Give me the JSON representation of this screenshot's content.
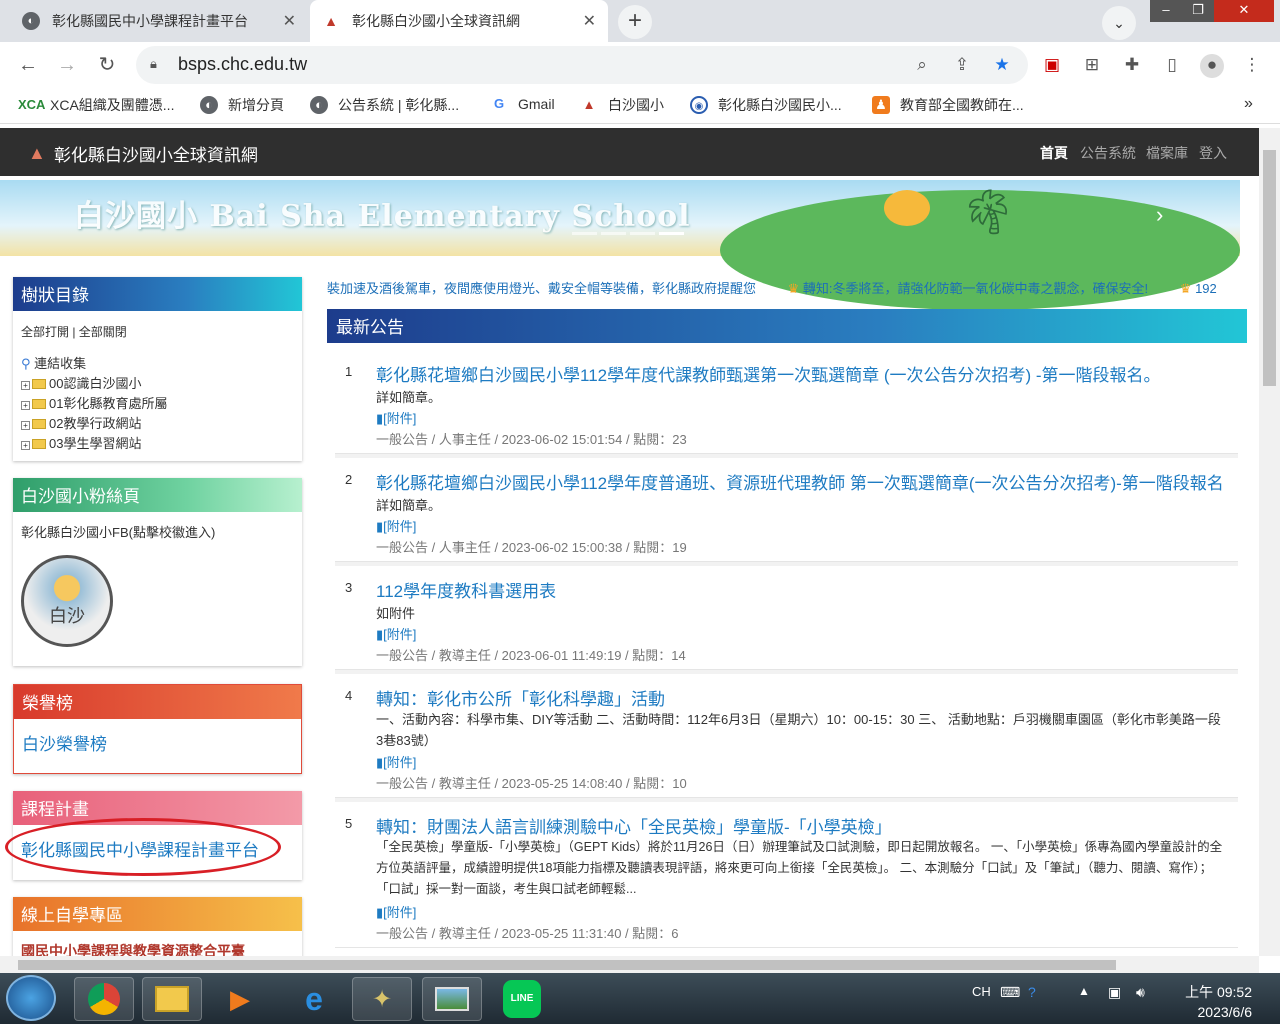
{
  "browser": {
    "tabs": [
      {
        "title": "彰化縣國民中小學課程計畫平台",
        "icon": "globe-icon"
      },
      {
        "title": "彰化縣白沙國小全球資訊網",
        "icon": "school-icon"
      }
    ],
    "url": "bsps.chc.edu.tw",
    "bookmarks": [
      {
        "label": "XCA組織及團體憑...",
        "icon": "xca-icon"
      },
      {
        "label": "新增分頁",
        "icon": "globe-icon"
      },
      {
        "label": "公告系統 | 彰化縣...",
        "icon": "globe-icon"
      },
      {
        "label": "Gmail",
        "icon": "google-icon"
      },
      {
        "label": "白沙國小",
        "icon": "school-icon"
      },
      {
        "label": "彰化縣白沙國民小...",
        "icon": "site-icon"
      },
      {
        "label": "教育部全國教師在...",
        "icon": "teacher-icon"
      }
    ],
    "more_bookmarks": "»"
  },
  "site": {
    "title": "彰化縣白沙國小全球資訊網",
    "nav": [
      "首頁",
      "公告系統",
      "檔案庫",
      "登入"
    ],
    "banner_text": "白沙國小 Bai Sha Elementary School"
  },
  "sidebar": {
    "tree": {
      "title": "樹狀目錄",
      "controls": "全部打開 | 全部關閉",
      "root": "連結收集",
      "folders": [
        "00認識白沙國小",
        "01彰化縣教育處所屬",
        "02教學行政網站",
        "03學生學習網站"
      ]
    },
    "fb": {
      "title": "白沙國小粉絲頁",
      "text": "彰化縣白沙國小FB(點擊校徽進入)",
      "logo_text": "白沙"
    },
    "honor": {
      "title": "榮譽榜",
      "link": "白沙榮譽榜"
    },
    "curriculum": {
      "title": "課程計畫",
      "link": "彰化縣國民中小學課程計畫平台"
    },
    "online": {
      "title": "線上自學專區",
      "link": "國民中小學課程與教學資源整合平臺"
    }
  },
  "marquee": {
    "msg1": "裝加速及酒後駕車，夜間應使用燈光、戴安全帽等裝備，彰化縣政府提醒您",
    "msg2": "轉知:冬季將至，請強化防範一氧化碳中毒之觀念，確保安全!",
    "msg3": "192"
  },
  "announcements": {
    "title": "最新公告",
    "items": [
      {
        "num": "1",
        "title": "彰化縣花壇鄉白沙國民小學112學年度代課教師甄選第一次甄選簡章 (一次公告分次招考) -第一階段報名。",
        "desc": "詳如簡章。",
        "attach": "[附件]",
        "meta": "一般公告 / 人事主任 / 2023-06-02 15:01:54 / 點閱：23"
      },
      {
        "num": "2",
        "title": "彰化縣花壇鄉白沙國民小學112學年度普通班、資源班代理教師 第一次甄選簡章(一次公告分次招考)-第一階段報名",
        "desc": "詳如簡章。",
        "attach": "[附件]",
        "meta": "一般公告 / 人事主任 / 2023-06-02 15:00:38 / 點閱：19"
      },
      {
        "num": "3",
        "title": "112學年度教科書選用表",
        "desc": "如附件",
        "attach": "[附件]",
        "meta": "一般公告 / 教導主任 / 2023-06-01 11:49:19 / 點閱：14"
      },
      {
        "num": "4",
        "title": "轉知：彰化市公所「彰化科學趣」活動",
        "desc": "一、活動內容：科學市集、DIY等活動 二、活動時間：112年6月3日（星期六）10：00-15：30 三、 活動地點：戶羽機關車園區（彰化市彰美路一段3巷83號）",
        "attach": "[附件]",
        "meta": "一般公告 / 教導主任 / 2023-05-25 14:08:40 / 點閱：10"
      },
      {
        "num": "5",
        "title": "轉知：財團法人語言訓練測驗中心「全民英檢」學童版-「小學英檢」",
        "desc": "「全民英檢」學童版-「小學英檢」（GEPT Kids）將於11月26日（日）辦理筆試及口試測驗，即日起開放報名。 一、「小學英檢」係專為國內學童設計的全方位英語評量，成績證明提供18項能力指標及聽讀表現評語，將來更可向上銜接「全民英檢」。 二、本測驗分「口試」及「筆試」（聽力、閱讀、寫作）；「口試」採一對一面談，考生與口試老師輕鬆...",
        "attach": "[附件]",
        "meta": "一般公告 / 教導主任 / 2023-05-25 11:31:40 / 點閱：6"
      }
    ]
  },
  "taskbar": {
    "lang": "CH",
    "time": "上午 09:52",
    "date": "2023/6/6"
  }
}
